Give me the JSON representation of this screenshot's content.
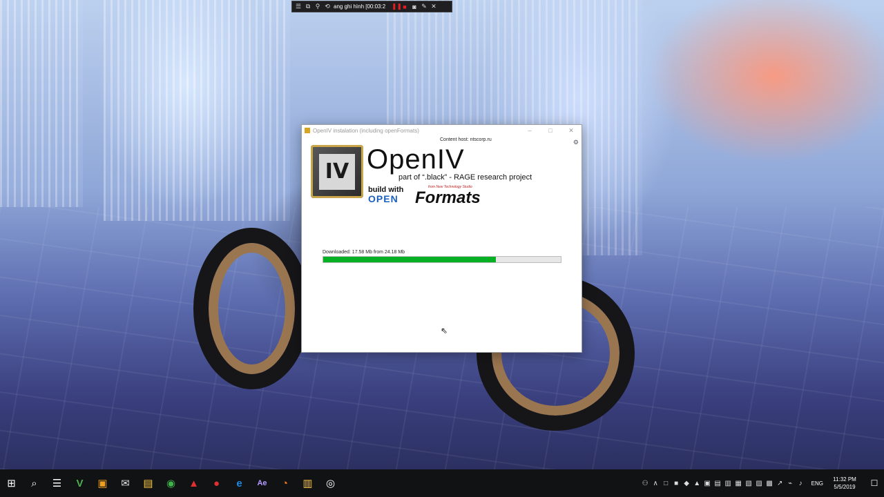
{
  "recorder": {
    "status_text": "ang ghi hình [00:03:2",
    "icons": [
      "menu-icon",
      "window-icon",
      "zoom-icon",
      "loop-icon",
      "pause-icon",
      "stop-icon",
      "camera-icon",
      "pen-icon",
      "close-icon"
    ]
  },
  "dialog": {
    "title": "OpenIV instalation (including openFormats)",
    "content_host": "Content host: ntscorp.ru",
    "logo_letters": "IV",
    "app_name": "OpenIV",
    "subtitle": "part of “.black” - RAGE research project",
    "built_with": "build with",
    "open_word": "OPEN",
    "formats_word": "Formats",
    "formats_tag": "from New Technology Studio",
    "download_status": "Downloaded: 17.58 Mb from 24.18 Mb",
    "progress_fraction": 0.727,
    "progress_color": "#06b025",
    "window_buttons": {
      "minimize": "–",
      "maximize": "□",
      "close": "✕"
    }
  },
  "taskbar": {
    "start": "⊞",
    "search": "⌕",
    "task_view": "☰",
    "apps": [
      "V",
      "▣",
      "✉",
      "▤",
      "◉",
      "▲",
      "●",
      "e",
      "Ae",
      "◔",
      "▥",
      "◎"
    ],
    "tray": [
      "∧",
      "□",
      "■",
      "◆",
      "▲",
      "▣",
      "▤",
      "▥",
      "▦",
      "▧",
      "▨",
      "▩",
      "↗",
      "⌁",
      "♪"
    ],
    "language": "ENG",
    "time": "11:32 PM",
    "date": "5/5/2019",
    "notifications": "☐"
  }
}
